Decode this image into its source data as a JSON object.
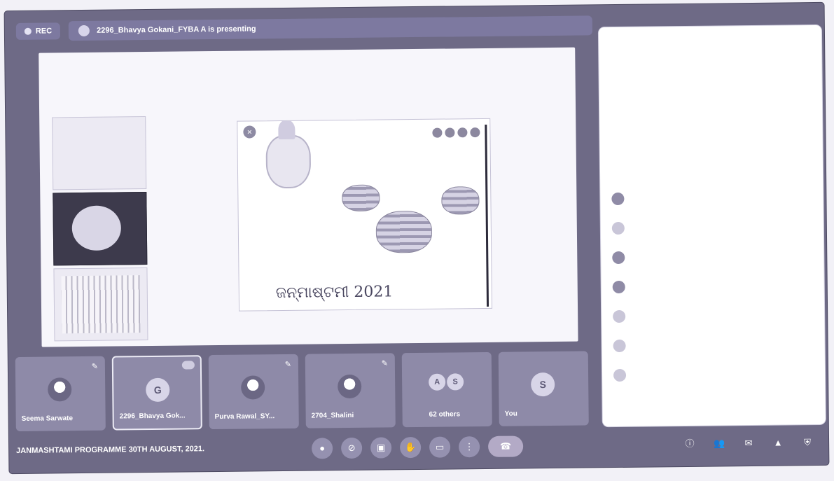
{
  "topbar": {
    "rec_label": "REC",
    "presenting_text": "2296_Bhavya Gokani_FYBA A is presenting"
  },
  "slide": {
    "caption": "ଜନ୍ମାଷ୍ଟମୀ 2021"
  },
  "tiles": [
    {
      "name": "Seema Sarwate",
      "kind": "photo"
    },
    {
      "name": "2296_Bhavya Gok...",
      "initial": "G",
      "active": true
    },
    {
      "name": "Purva Rawal_SY...",
      "kind": "photo"
    },
    {
      "name": "2704_Shalini",
      "kind": "photo"
    },
    {
      "name": "62 others",
      "initials": [
        "A",
        "S"
      ]
    },
    {
      "name": "You",
      "initial": "S"
    }
  ],
  "bottom": {
    "meeting_title": "JANMASHTAMI PROGRAMME 30TH AUGUST, 2021."
  },
  "icons": {
    "mic": "microphone-icon",
    "camera": "camera-off-icon",
    "captions": "captions-icon",
    "hand": "hand-raise-icon",
    "present": "present-screen-icon",
    "more": "more-options-icon",
    "end": "end-call-icon",
    "info": "info-icon",
    "people": "people-icon",
    "chat": "chat-icon",
    "activities": "activities-icon",
    "shield": "host-controls-icon"
  }
}
